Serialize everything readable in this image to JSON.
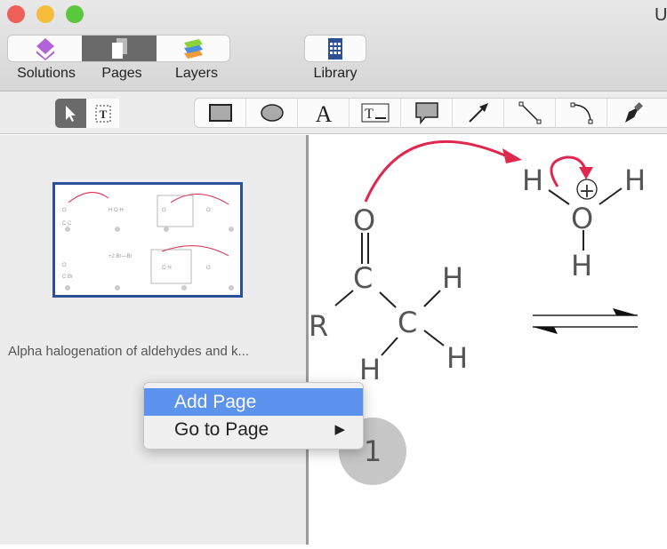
{
  "window": {
    "title_partial": "U"
  },
  "toolbar": {
    "solutions": "Solutions",
    "pages": "Pages",
    "layers": "Layers",
    "library": "Library"
  },
  "tools": [
    "rectangle-icon",
    "ellipse-icon",
    "text-icon",
    "textbox-icon",
    "callout-icon",
    "arrow-icon",
    "line-icon",
    "arc-icon",
    "pen-icon"
  ],
  "pages": {
    "thumbnail_title": "Alpha halogenation of aldehydes and k...",
    "page_number": "1"
  },
  "context_menu": {
    "items": [
      {
        "label": "Add Page"
      },
      {
        "label": "Go to Page"
      }
    ]
  },
  "canvas": {
    "atoms": {
      "o1": "O",
      "c1": "C",
      "c2": "C",
      "r": "R",
      "h1": "H",
      "h2": "H",
      "h3": "H",
      "hA": "H",
      "hB": "H",
      "hC": "H",
      "o2": "O"
    },
    "charge": "+"
  },
  "colors": {
    "arrow_red": "#e0284e",
    "selection": "#5b93ef"
  }
}
